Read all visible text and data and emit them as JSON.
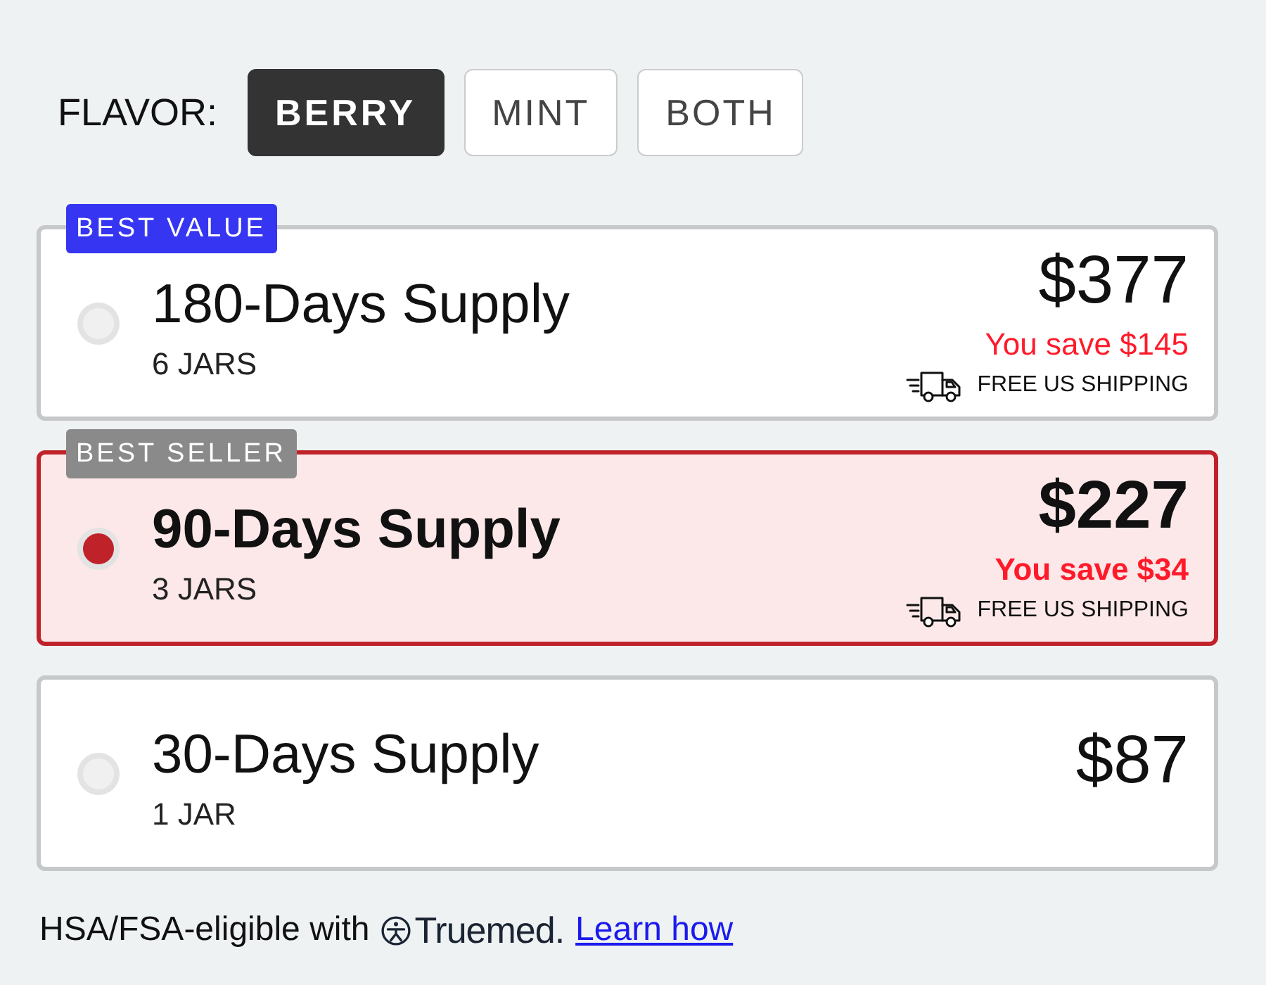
{
  "flavor": {
    "label": "FLAVOR:",
    "options": [
      {
        "label": "BERRY",
        "selected": true
      },
      {
        "label": "MINT",
        "selected": false
      },
      {
        "label": "BOTH",
        "selected": false
      }
    ]
  },
  "plans": [
    {
      "badge": {
        "text": "BEST VALUE",
        "color": "#3636f2"
      },
      "title": "180-Days Supply",
      "quantity": "6 JARS",
      "price": "$377",
      "savings": "You save $145",
      "shipping": "FREE US SHIPPING",
      "selected": false
    },
    {
      "badge": {
        "text": "BEST SELLER",
        "color": "#8a8a8a"
      },
      "title": "90-Days Supply",
      "quantity": "3 JARS",
      "price": "$227",
      "savings": "You save $34",
      "shipping": "FREE US SHIPPING",
      "selected": true
    },
    {
      "title": "30-Days Supply",
      "quantity": "1 JAR",
      "price": "$87",
      "selected": false
    }
  ],
  "footer": {
    "text": "HSA/FSA-eligible with",
    "brand": "Truemed.",
    "link": "Learn how"
  }
}
